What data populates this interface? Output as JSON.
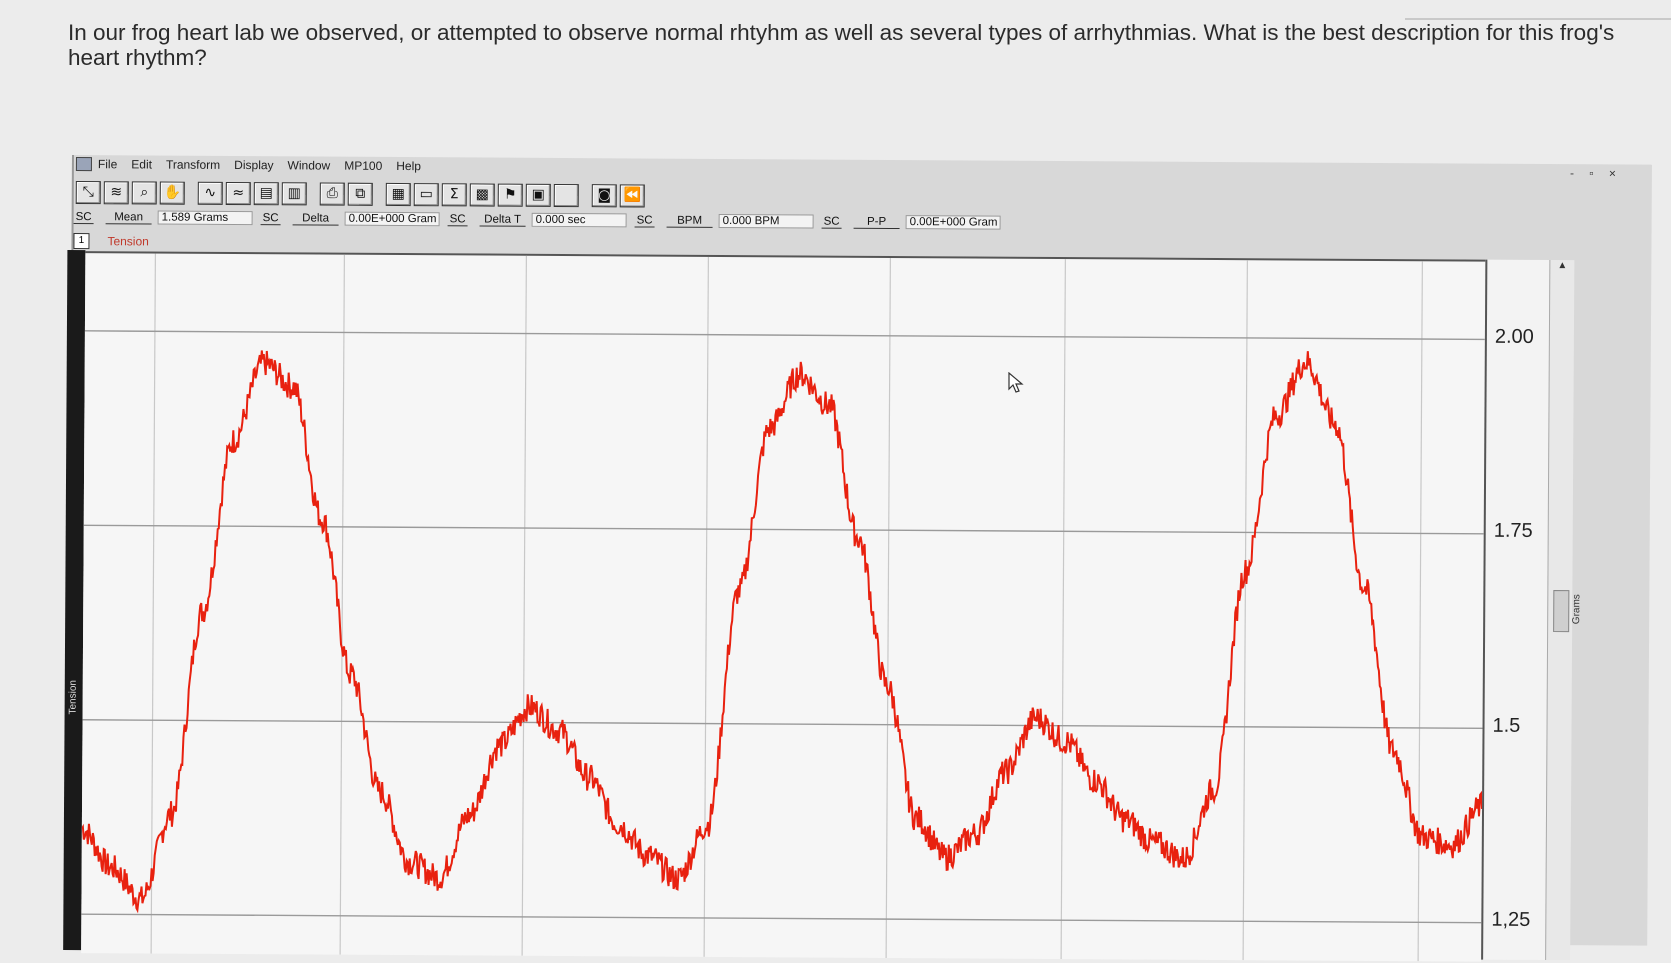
{
  "question": "In our frog heart lab we observed, or attempted to observe normal rhtyhm as well as several types of arrhythmias. What is the best description for this frog's heart rhythm?",
  "menu": [
    "File",
    "Edit",
    "Transform",
    "Display",
    "Window",
    "MP100",
    "Help"
  ],
  "window_controls": "- ▫ ×",
  "toolbar_icons": [
    "arrow-tool-icon",
    "ibeam-tool-icon",
    "zoom-tool-icon",
    "hand-tool-icon",
    "autoscale-horizontal-icon",
    "autoscale-waveform-icon",
    "overlap-icon",
    "stack-icon",
    "print-icon",
    "copy-icon",
    "grid-icon",
    "marker-icon",
    "sum-icon",
    "table-icon",
    "flag-icon",
    "journal-icon",
    "blank-icon",
    "camera-icon",
    "rewind-icon"
  ],
  "measurements": [
    {
      "channel": "SC",
      "type": "Mean",
      "value": "1.589 Grams"
    },
    {
      "channel": "SC",
      "type": "Delta",
      "value": "0.00E+000 Gram"
    },
    {
      "channel": "SC",
      "type": "Delta T",
      "value": "0.000 sec"
    },
    {
      "channel": "SC",
      "type": "BPM",
      "value": "0.000 BPM"
    },
    {
      "channel": "SC",
      "type": "P-P",
      "value": "0.00E+000 Gram"
    }
  ],
  "channel": {
    "number": "1",
    "label": "Tension",
    "strip_label": "Tension",
    "units": "Grams"
  },
  "chart_data": {
    "type": "line",
    "title": "",
    "ylabel": "Grams",
    "ylim": [
      1.2,
      2.1
    ],
    "yticks": [
      "2.00",
      "1.75",
      "1.5",
      "1,25"
    ],
    "ytick_values": [
      2.0,
      1.75,
      1.5,
      1.25
    ],
    "grid": true,
    "series": [
      {
        "color": "#e8210f",
        "x": [
          0,
          0.3,
          0.6,
          0.9,
          1.2,
          1.5,
          1.8,
          2.1,
          2.4,
          2.7,
          3.0,
          3.3,
          3.6,
          3.9,
          4.2,
          4.5,
          4.8,
          5.1,
          5.4,
          5.7,
          6.0,
          6.3,
          6.6,
          6.9,
          7.2,
          7.5,
          7.8,
          8.1,
          8.4,
          8.7,
          9.0,
          9.3,
          9.6,
          9.9,
          10.2,
          10.5,
          10.8,
          11.1,
          11.4,
          11.7,
          12.0,
          12.3,
          12.6,
          12.9,
          13.2,
          13.5,
          13.8,
          14.1
        ],
        "y": [
          1.36,
          1.31,
          1.27,
          1.38,
          1.64,
          1.86,
          1.96,
          1.93,
          1.76,
          1.56,
          1.41,
          1.32,
          1.3,
          1.38,
          1.47,
          1.52,
          1.49,
          1.43,
          1.37,
          1.33,
          1.3,
          1.37,
          1.67,
          1.88,
          1.95,
          1.91,
          1.74,
          1.55,
          1.38,
          1.33,
          1.36,
          1.44,
          1.51,
          1.48,
          1.43,
          1.38,
          1.35,
          1.33,
          1.42,
          1.7,
          1.9,
          1.97,
          1.89,
          1.68,
          1.47,
          1.36,
          1.35,
          1.4
        ]
      }
    ]
  }
}
